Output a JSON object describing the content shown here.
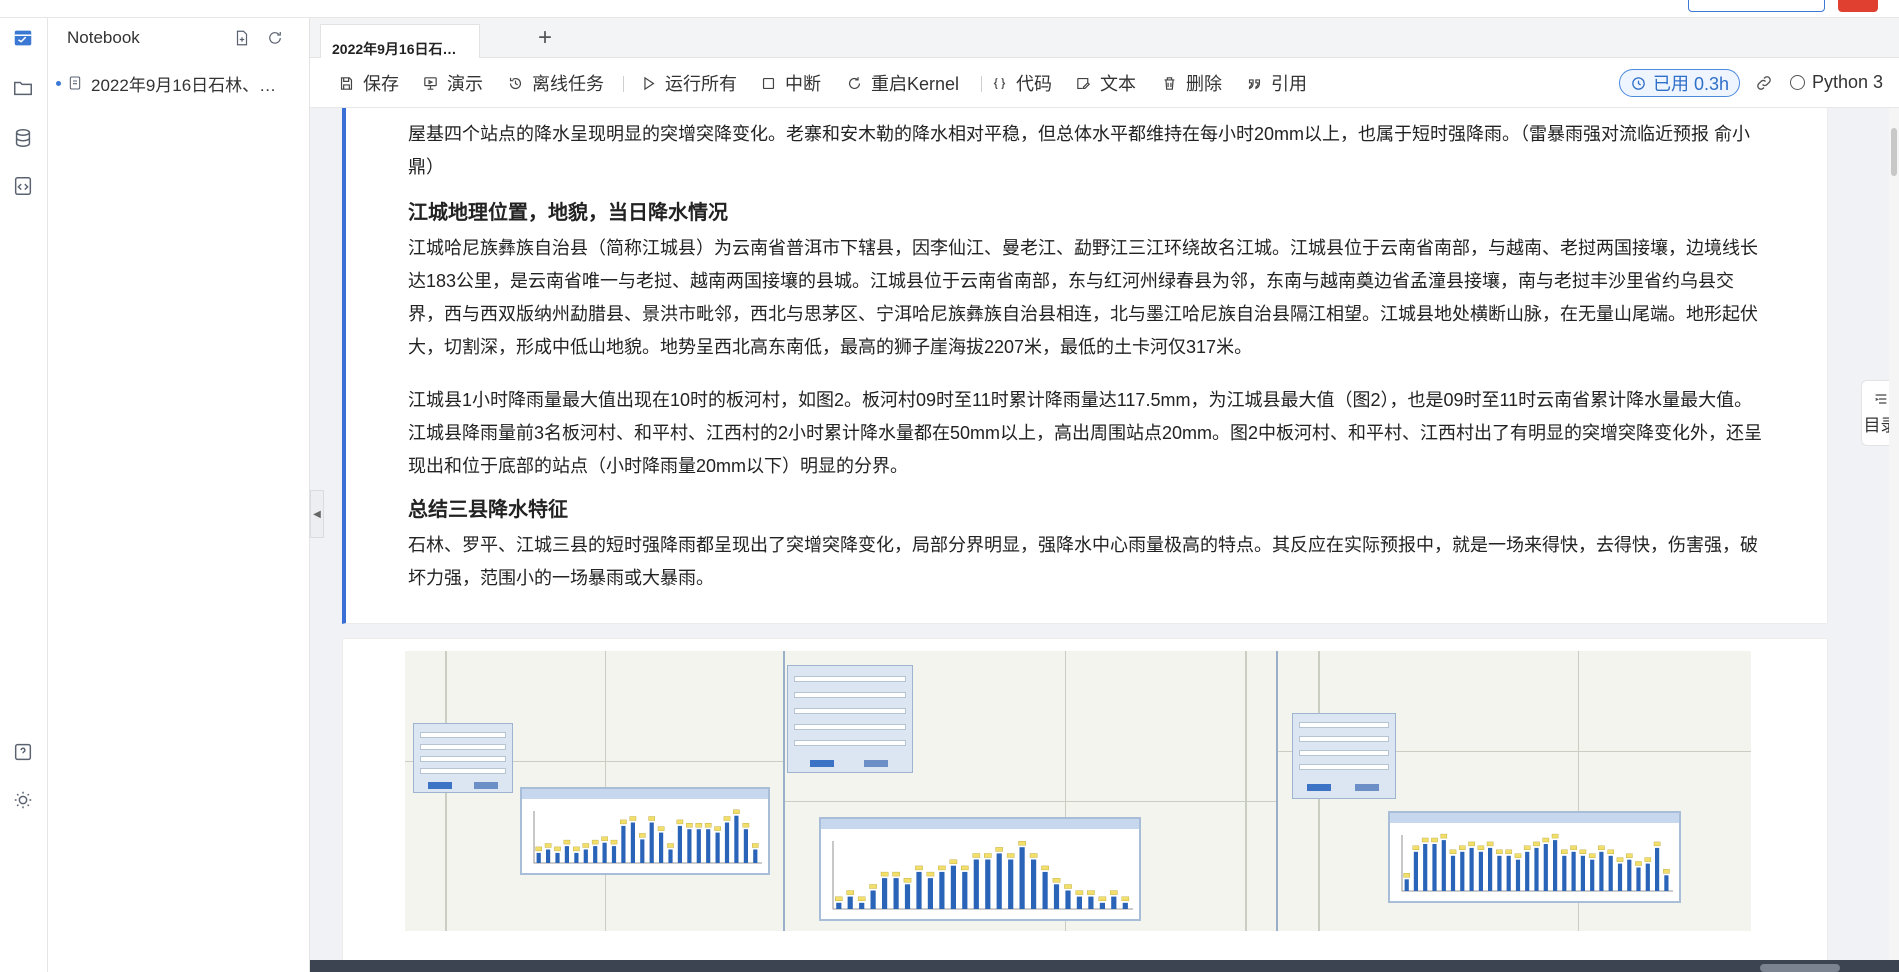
{
  "panel": {
    "title": "Notebook",
    "files": [
      {
        "name": "2022年9月16日石林、…"
      }
    ]
  },
  "tabs": [
    {
      "label": "2022年9月16日石…",
      "active": true
    }
  ],
  "toolbar": {
    "save": "保存",
    "present": "演示",
    "offline": "离线任务",
    "run_all": "运行所有",
    "interrupt": "中断",
    "restart": "重启Kernel",
    "code": "代码",
    "text": "文本",
    "delete": "删除",
    "cite": "引用",
    "usage": "已用 0.3h",
    "kernel": "Python 3"
  },
  "markdown": {
    "intro_line1": "屋基四个站点的降水呈现明显的突增突降变化。老寨和安木勒的降水相对平稳，但总体水平都维持在每小时20mm以上，也属于短时强降雨。（雷暴雨强对流临近预报 俞小",
    "intro_line2": "鼎）",
    "h_jiangcheng": "江城地理位置，地貌，当日降水情况",
    "p_geo": "江城哈尼族彝族自治县（简称江城县）为云南省普洱市下辖县，因李仙江、曼老江、勐野江三江环绕故名江城。江城县位于云南省南部，与越南、老挝两国接壤，边境线长达183公里，是云南省唯一与老挝、越南两国接壤的县城。江城县位于云南省南部，东与红河州绿春县为邻，东南与越南奠边省孟潼县接壤，南与老挝丰沙里省约乌县交界，西与西双版纳州勐腊县、景洪市毗邻，西北与思茅区、宁洱哈尼族彝族自治县相连，北与墨江哈尼族自治县隔江相望。江城县地处横断山脉，在无量山尾端。地形起伏大，切割深，形成中低山地貌。地势呈西北高东南低，最高的狮子崖海拔2207米，最低的土卡河仅317米。",
    "p_rain": "江城县1小时降雨量最大值出现在10时的板河村，如图2。板河村09时至11时累计降雨量达117.5mm，为江城县最大值（图2），也是09时至11时云南省累计降水量最大值。江城县降雨量前3名板河村、和平村、江西村的2小时累计降水量都在50mm以上，高出周围站点20mm。图2中板河村、和平村、江西村出了有明显的突增突降变化外，还呈现出和位于底部的站点（小时降雨量20mm以下）明显的分界。",
    "h_summary": "总结三县降水特征",
    "p_summary": "石林、罗平、江城三县的短时强降雨都呈现出了突增突降变化，局部分界明显，强降水中心雨量极高的特点。其反应在实际预报中，就是一场来得快，去得快，伤害强，破坏力强，范围小的一场暴雨或大暴雨。"
  },
  "toc": {
    "label": "目录"
  },
  "icons": {
    "rail": [
      "notebook-icon",
      "folder-icon",
      "database-icon",
      "code-file-icon",
      "help-icon",
      "theme-icon"
    ],
    "accent": "#3a6fd6"
  },
  "figure": {
    "charts": [
      {
        "values": [
          3,
          4,
          3,
          5,
          3,
          4,
          5,
          6,
          5,
          11,
          12,
          7,
          12,
          9,
          4,
          11,
          10,
          10,
          10,
          9,
          12,
          14,
          10,
          4
        ]
      },
      {
        "values": [
          1,
          2,
          1,
          3,
          5,
          5,
          4,
          6,
          5,
          6,
          7,
          6,
          8,
          8,
          9,
          8,
          10,
          8,
          6,
          4,
          3,
          2,
          2,
          1,
          2,
          1
        ]
      },
      {
        "values": [
          3,
          10,
          12,
          12,
          13,
          9,
          10,
          11,
          10,
          11,
          9,
          9,
          8,
          10,
          11,
          12,
          13,
          9,
          10,
          9,
          8,
          10,
          9,
          7,
          8,
          6,
          7,
          11,
          4
        ]
      }
    ]
  }
}
